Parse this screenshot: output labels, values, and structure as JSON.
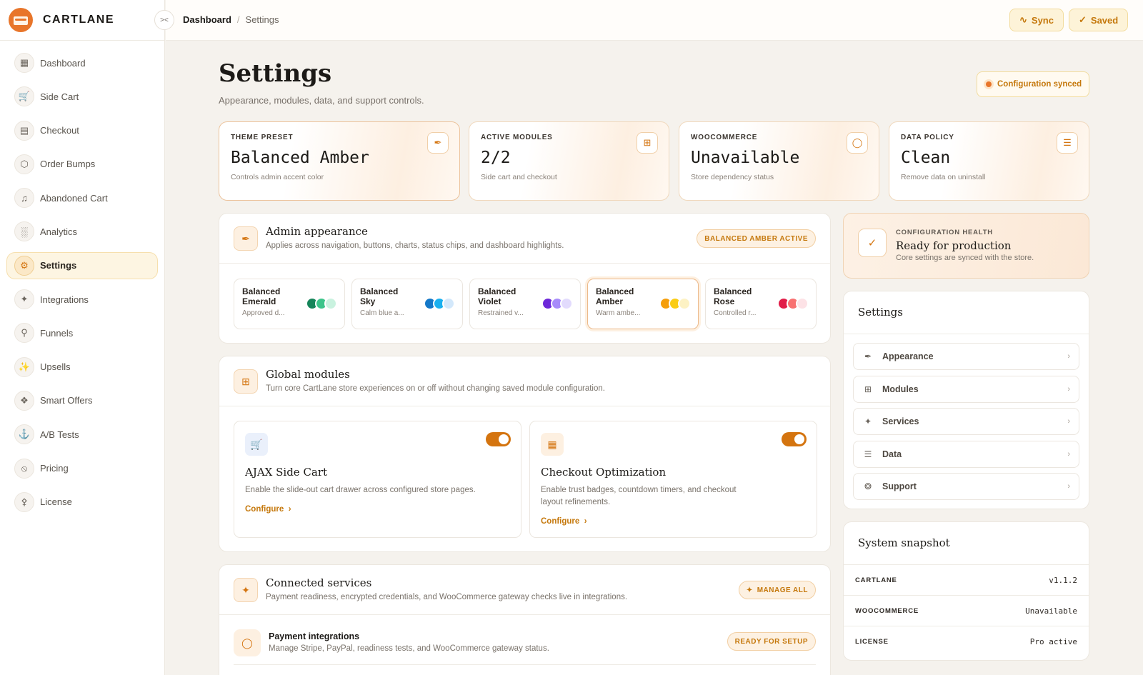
{
  "brand": {
    "name": "CARTLANE"
  },
  "sidebar": {
    "items": [
      {
        "label": "Dashboard",
        "icon": "grid-icon"
      },
      {
        "label": "Side Cart",
        "icon": "cart-icon"
      },
      {
        "label": "Checkout",
        "icon": "card-icon"
      },
      {
        "label": "Order Bumps",
        "icon": "box-icon"
      },
      {
        "label": "Abandoned Cart",
        "icon": "bell-icon"
      },
      {
        "label": "Analytics",
        "icon": "bar-chart-icon"
      },
      {
        "label": "Settings",
        "icon": "gear-icon",
        "active": true
      },
      {
        "label": "Integrations",
        "icon": "plug-icon"
      },
      {
        "label": "Funnels",
        "icon": "funnel-icon"
      },
      {
        "label": "Upsells",
        "icon": "sparkle-icon"
      },
      {
        "label": "Smart Offers",
        "icon": "offer-icon"
      },
      {
        "label": "A/B Tests",
        "icon": "flask-icon"
      },
      {
        "label": "Pricing",
        "icon": "tag-icon"
      },
      {
        "label": "License",
        "icon": "key-icon"
      }
    ]
  },
  "topbar": {
    "breadcrumb": {
      "root": "Dashboard",
      "sep": "/",
      "current": "Settings"
    },
    "sync_label": "Sync",
    "saved_label": "Saved"
  },
  "header": {
    "title": "Settings",
    "subtitle": "Appearance, modules, data, and support controls.",
    "sync_status": "Configuration synced"
  },
  "stats": [
    {
      "label": "THEME PRESET",
      "value": "Balanced Amber",
      "desc": "Controls admin accent color",
      "icon": "brush-icon"
    },
    {
      "label": "ACTIVE MODULES",
      "value": "2/2",
      "desc": "Side cart and checkout",
      "icon": "modules-icon"
    },
    {
      "label": "WOOCOMMERCE",
      "value": "Unavailable",
      "desc": "Store dependency status",
      "icon": "shield-icon"
    },
    {
      "label": "DATA POLICY",
      "value": "Clean",
      "desc": "Remove data on uninstall",
      "icon": "database-icon"
    }
  ],
  "appearance": {
    "title": "Admin appearance",
    "subtitle": "Applies across navigation, buttons, charts, status chips, and dashboard highlights.",
    "chip": "BALANCED AMBER ACTIVE",
    "themes": [
      {
        "name": "Balanced Emerald",
        "desc": "Approved d...",
        "colors": [
          "#16855a",
          "#3cc48a",
          "#c9f2df"
        ]
      },
      {
        "name": "Balanced Sky",
        "desc": "Calm blue a...",
        "colors": [
          "#1478c8",
          "#1ab0ef",
          "#d3e8fb"
        ]
      },
      {
        "name": "Balanced Violet",
        "desc": "Restrained v...",
        "colors": [
          "#6d28d9",
          "#a78bfa",
          "#e2dbfd"
        ]
      },
      {
        "name": "Balanced Amber",
        "desc": "Warm ambe...",
        "colors": [
          "#f59e0b",
          "#facc15",
          "#fdf2c4"
        ],
        "selected": true
      },
      {
        "name": "Balanced Rose",
        "desc": "Controlled r...",
        "colors": [
          "#e11d48",
          "#f87171",
          "#fde2e6"
        ]
      }
    ]
  },
  "modules": {
    "title": "Global modules",
    "subtitle": "Turn core CartLane store experiences on or off without changing saved module configuration.",
    "items": [
      {
        "title": "AJAX Side Cart",
        "desc": "Enable the slide-out cart drawer across configured store pages.",
        "link": "Configure",
        "enabled": true
      },
      {
        "title": "Checkout Optimization",
        "desc": "Enable trust badges, countdown timers, and checkout layout refinements.",
        "link": "Configure",
        "enabled": true
      }
    ]
  },
  "services": {
    "title": "Connected services",
    "subtitle": "Payment readiness, encrypted credentials, and WooCommerce gateway checks live in integrations.",
    "chip": "MANAGE ALL",
    "rows": [
      {
        "title": "Payment integrations",
        "sub": "Manage Stripe, PayPal, readiness tests, and WooCommerce gateway status.",
        "chip": "READY FOR SETUP"
      }
    ]
  },
  "health": {
    "label": "CONFIGURATION HEALTH",
    "title": "Ready for production",
    "subtitle": "Core settings are synced with the store."
  },
  "settings_nav": {
    "title": "Settings",
    "items": [
      {
        "label": "Appearance",
        "icon": "brush-icon"
      },
      {
        "label": "Modules",
        "icon": "modules-icon"
      },
      {
        "label": "Services",
        "icon": "plug-icon"
      },
      {
        "label": "Data",
        "icon": "database-icon"
      },
      {
        "label": "Support",
        "icon": "lifebuoy-icon"
      }
    ]
  },
  "snapshot": {
    "title": "System snapshot",
    "rows": [
      {
        "key": "CARTLANE",
        "value": "v1.1.2"
      },
      {
        "key": "WOOCOMMERCE",
        "value": "Unavailable"
      },
      {
        "key": "LICENSE",
        "value": "Pro active"
      }
    ]
  },
  "colors": {
    "accent": "#d4740f",
    "accent_soft": "#fdf0e1",
    "bg": "#f5f2ed"
  }
}
